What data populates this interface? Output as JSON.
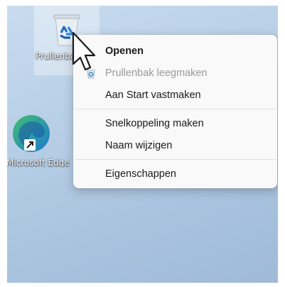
{
  "desktop": {
    "icons": [
      {
        "label": "Prullenbak",
        "icon": "recycle-bin-icon"
      },
      {
        "label": "Microsoft Edge",
        "icon": "edge-icon"
      }
    ]
  },
  "context_menu": {
    "items": [
      {
        "label": "Openen",
        "bold": true
      },
      {
        "label": "Prullenbak leegmaken",
        "disabled": true,
        "icon": "recycle-bin-small-icon"
      },
      {
        "label": "Aan Start vastmaken"
      },
      {
        "label": "Snelkoppeling maken"
      },
      {
        "label": "Naam wijzigen"
      },
      {
        "label": "Eigenschappen"
      }
    ]
  },
  "colors": {
    "menu_bg": "#f9f9f9",
    "disabled_text": "#9a9a9a",
    "edge_blue": "#1f7ad1",
    "edge_green": "#3fbf6f"
  }
}
